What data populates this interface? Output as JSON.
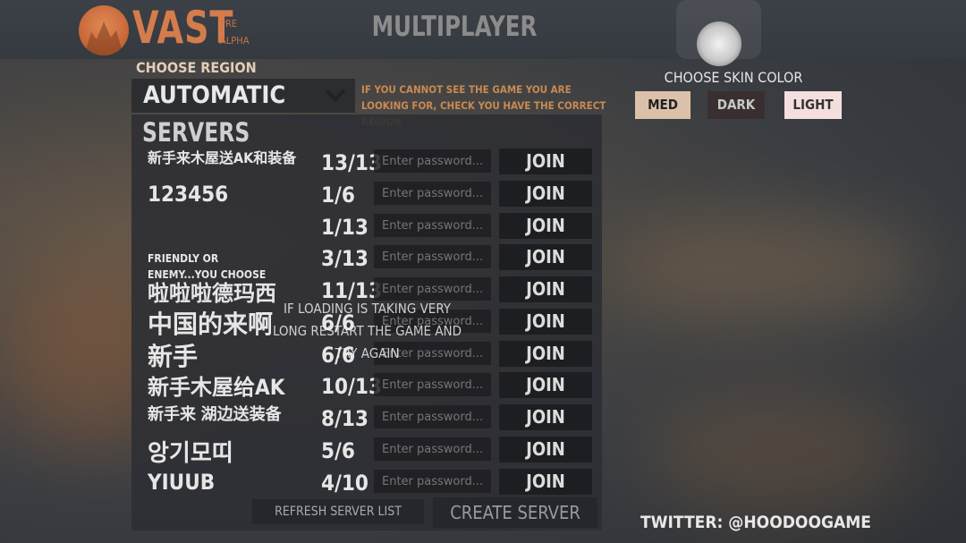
{
  "header": {
    "logo_text": "VAST",
    "pre_alpha_1": "PRE",
    "pre_alpha_2": "ALPHA",
    "title": "MULTIPLAYER"
  },
  "region": {
    "label": "CHOOSE REGION",
    "selected": "AUTOMATIC",
    "note": "IF YOU CANNOT SEE THE GAME YOU ARE LOOKING FOR, CHECK YOU HAVE THE CORRECT REGION"
  },
  "skin": {
    "label": "CHOOSE SKIN COLOR",
    "options": [
      "MED",
      "DARK",
      "LIGHT"
    ],
    "colors": {
      "MED": "#dcc1aa",
      "DARK": "#3a2f30",
      "LIGHT": "#f4dede"
    }
  },
  "servers": {
    "title": "SERVERS",
    "password_placeholder": "Enter password...",
    "join_label": "JOIN",
    "rows": [
      {
        "name": "新手来木屋送AK和装备",
        "count": "13/13"
      },
      {
        "name": "123456",
        "count": "1/6"
      },
      {
        "name": "",
        "count": "1/13"
      },
      {
        "name": "FRIENDLY OR ENEMY...YOU CHOOSE",
        "count": "3/13"
      },
      {
        "name": "啦啦啦德玛西",
        "count": "11/13"
      },
      {
        "name": "中国的来啊",
        "count": "6/6"
      },
      {
        "name": "新手",
        "count": "6/6"
      },
      {
        "name": "新手木屋给AK",
        "count": "10/13"
      },
      {
        "name": "新手来 湖边送装备",
        "count": "8/13"
      },
      {
        "name": "앙기모띠",
        "count": "5/6"
      },
      {
        "name": "YIUUB",
        "count": "4/10"
      }
    ],
    "loading_message": "IF LOADING IS TAKING VERY LONG RESTART THE GAME AND TRY AGAIN",
    "refresh_label": "REFRESH SERVER LIST",
    "create_label": "CREATE SERVER"
  },
  "footer": {
    "twitter": "TWITTER: @HOODOOGAME"
  }
}
